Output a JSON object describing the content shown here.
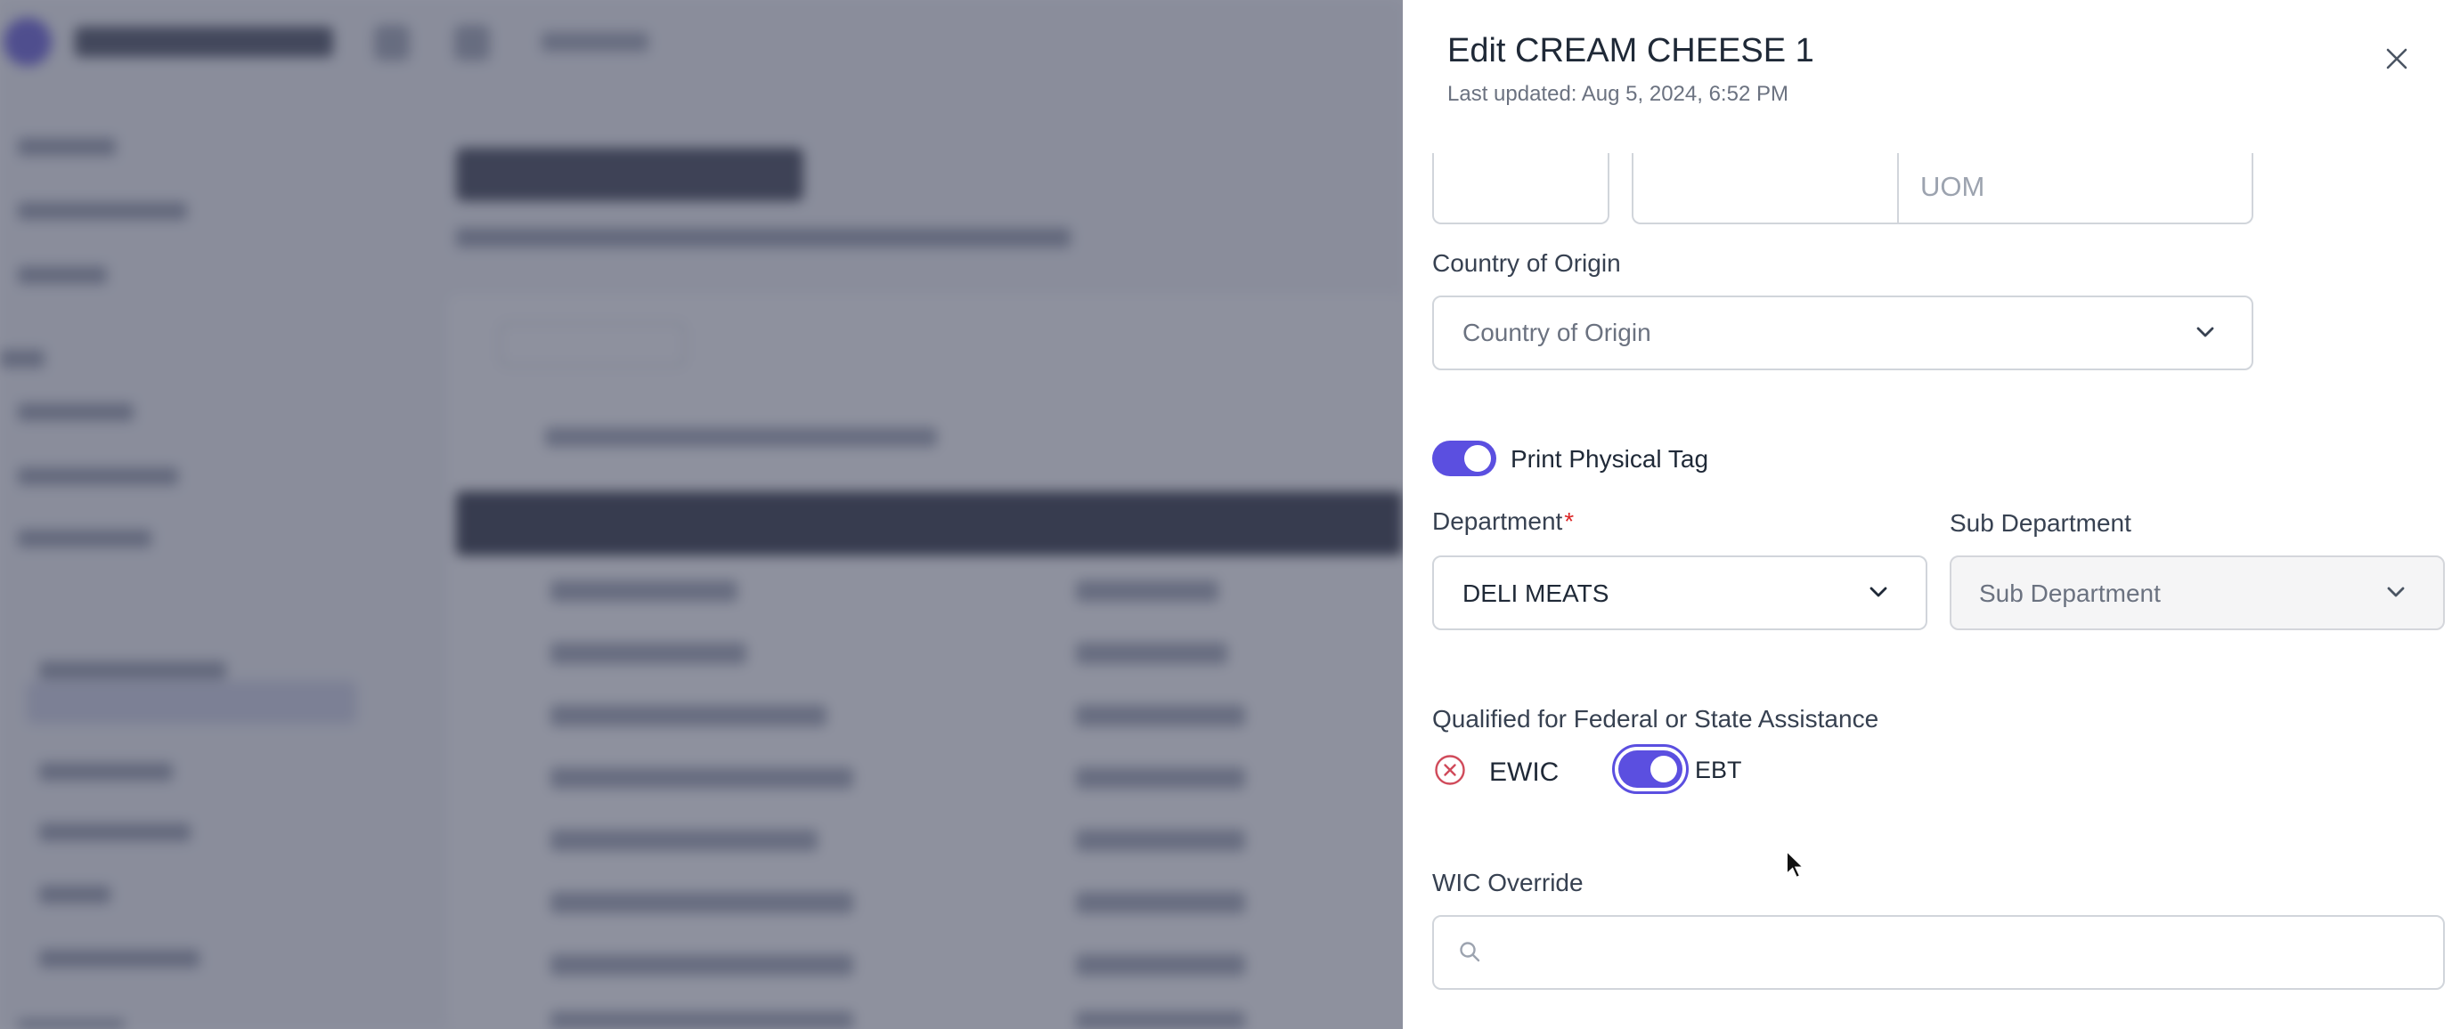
{
  "panel": {
    "title": "Edit CREAM CHEESE 1",
    "last_updated": "Last updated: Aug 5, 2024, 6:52 PM"
  },
  "unit_row": {
    "uom_placeholder": "UOM"
  },
  "country_of_origin": {
    "label": "Country of Origin",
    "placeholder": "Country of Origin"
  },
  "print_physical_tag": {
    "label": "Print Physical Tag",
    "enabled": true
  },
  "department": {
    "label": "Department",
    "required_mark": "*",
    "value": "DELI MEATS"
  },
  "sub_department": {
    "label": "Sub Department",
    "placeholder": "Sub Department"
  },
  "assistance": {
    "label": "Qualified for Federal or State Assistance",
    "ewic": {
      "label": "EWIC",
      "enabled": false
    },
    "ebt": {
      "label": "EBT",
      "enabled": true
    }
  },
  "wic_override": {
    "label": "WIC Override",
    "search_value": ""
  },
  "colors": {
    "accent": "#5b4fe0",
    "error": "#d04a5a",
    "overlay": "#484e62"
  },
  "icons": {
    "close": "close-icon",
    "chevron": "chevron-down-icon",
    "search": "search-icon",
    "ewic_status": "x-circle-icon"
  }
}
